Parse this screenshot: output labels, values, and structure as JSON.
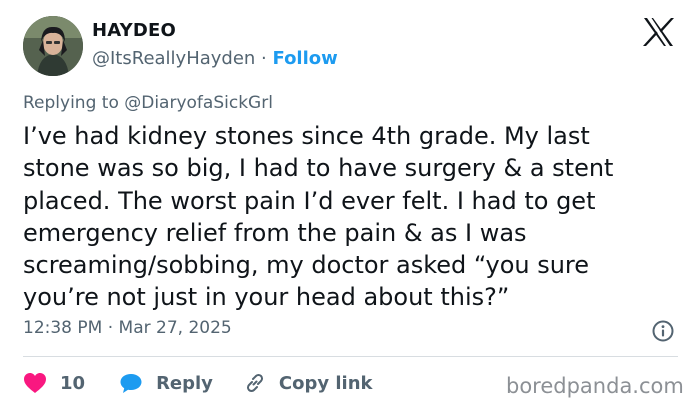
{
  "author": {
    "display_name": "HAYDEO",
    "handle": "@ItsReallyHayden",
    "separator": " · ",
    "follow_label": "Follow"
  },
  "icons": {
    "close": "x-logo-icon",
    "info": "info-icon",
    "like": "heart-icon",
    "reply": "reply-bubble-icon",
    "copy": "link-icon"
  },
  "replying_to": "Replying to @DiaryofaSickGrl",
  "tweet_lines": [
    "I’ve had kidney stones since 4th grade. My last",
    "stone was so big, I had to have surgery & a stent",
    "placed. The worst pain I’d ever felt. I had to get",
    "emergency relief from the pain & as I was",
    "screaming/sobbing, my doctor asked “you sure",
    "you’re not just in your head about this?”"
  ],
  "timestamp": "12:38 PM · Mar 27, 2025",
  "actions": {
    "like_count": "10",
    "reply_label": "Reply",
    "copy_label": "Copy link"
  },
  "watermark": "boredpanda.com",
  "colors": {
    "text": "#0f1419",
    "secondary": "#536471",
    "accent": "#1d9bf0",
    "like": "#f91880",
    "divider": "#d8dde1"
  }
}
